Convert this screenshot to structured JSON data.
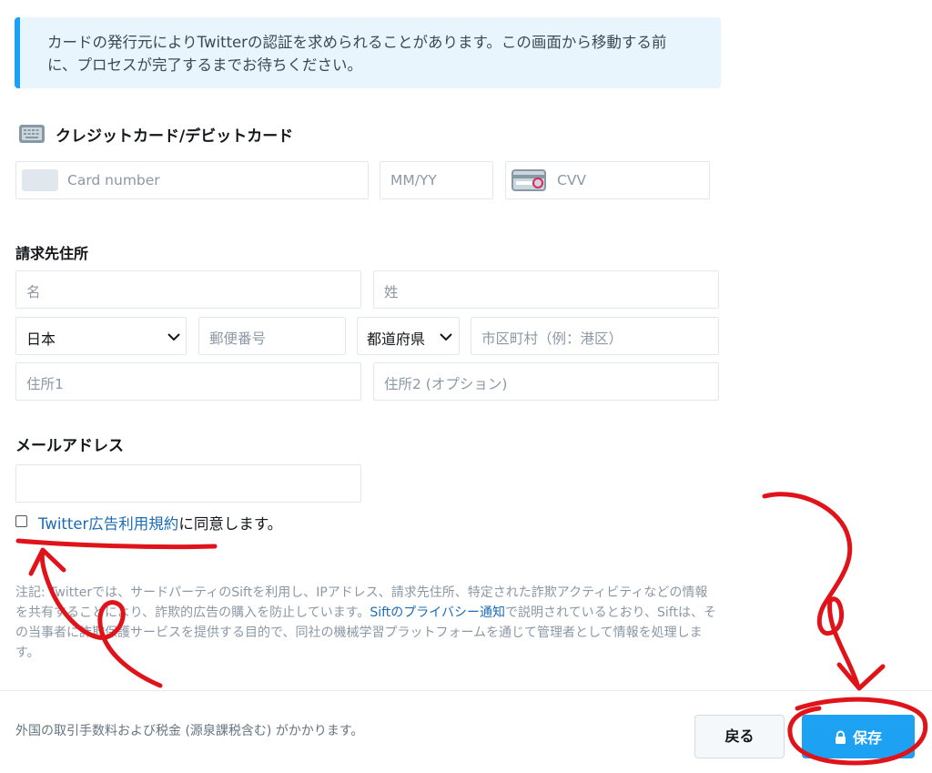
{
  "notice": {
    "line1": "カードの発行元によりTwitterの認証を求められることがあります。この画面から移動する前",
    "line2": "に、プロセスが完了するまでお待ちください。"
  },
  "card_section": {
    "title": "クレジットカード/デビットカード",
    "card_number_placeholder": "Card number",
    "expiry_placeholder": "MM/YY",
    "cvv_placeholder": "CVV"
  },
  "billing": {
    "title": "請求先住所",
    "first_name_placeholder": "名",
    "last_name_placeholder": "姓",
    "country_value": "日本",
    "postal_placeholder": "郵便番号",
    "prefecture_value": "都道府県",
    "city_placeholder": "市区町村（例：港区）",
    "address1_placeholder": "住所1",
    "address2_placeholder": "住所2 (オプション)"
  },
  "email": {
    "title": "メールアドレス",
    "value": ""
  },
  "agreement": {
    "link_text": "Twitter広告利用規約",
    "suffix": "に同意します。"
  },
  "note": {
    "part1": "注記: Twitterでは、サードパーティのSiftを利用し、IPアドレス、請求先住所、特定された詐欺アクティビティなどの情報を共有することにより、詐欺的広告の購入を防止しています。",
    "link_text": "Siftのプライバシー通知",
    "part2": "で説明されているとおり、Siftは、その当事者に詐欺保護サービスを提供する目的で、同社の機械学習プラットフォームを通じて管理者として情報を処理します。"
  },
  "footer": {
    "fee_text": "外国の取引手数料および税金 (源泉課税含む) がかかります。",
    "back_label": "戻る",
    "save_label": "保存"
  },
  "colors": {
    "accent": "#1da1f2",
    "link": "#1b6bb5",
    "annotation": "#e0131b"
  },
  "icons": {
    "card_section": "keyboard-card-icon",
    "card_number": "card-placeholder-icon",
    "cvv": "cvv-card-icon",
    "dropdown": "chevron-down-icon",
    "save": "lock-icon"
  }
}
